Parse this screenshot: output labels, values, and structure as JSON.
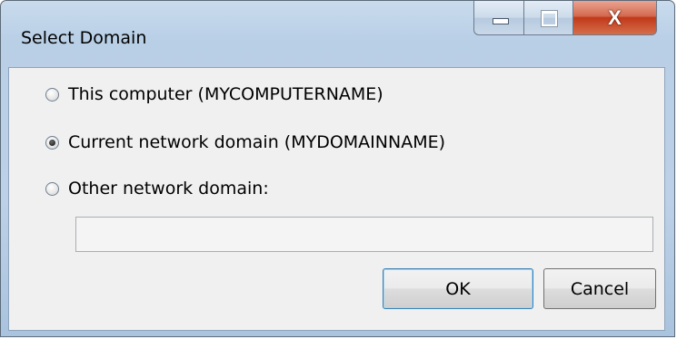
{
  "window": {
    "title": "Select Domain",
    "close_glyph": "X"
  },
  "options": [
    {
      "label": "This computer (MYCOMPUTERNAME)",
      "checked": false
    },
    {
      "label": "Current network domain (MYDOMAINNAME)",
      "checked": true
    },
    {
      "label": "Other network domain:",
      "checked": false
    }
  ],
  "other_domain": {
    "value": "",
    "enabled": false
  },
  "buttons": {
    "ok_label": "OK",
    "cancel_label": "Cancel"
  },
  "icons": {
    "minimize": "minimize-icon",
    "maximize": "maximize-icon",
    "close": "close-icon"
  },
  "colors": {
    "title_bar": "#bcd1e7",
    "close_button": "#c1391a",
    "client_bg": "#f0f0f0",
    "default_button_border": "#3c7fb1"
  }
}
